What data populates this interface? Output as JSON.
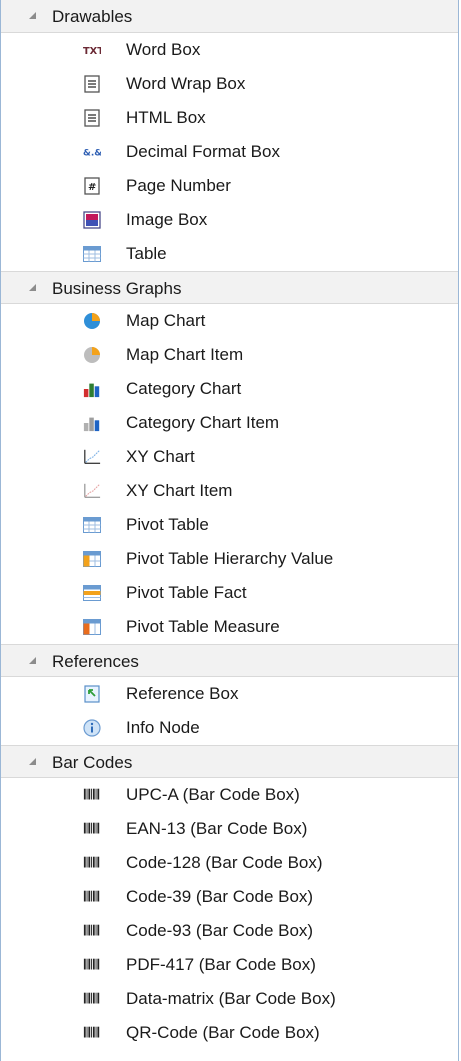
{
  "groups": [
    {
      "label": "Drawables",
      "items": [
        {
          "label": "Word Box",
          "icon": "txt-icon"
        },
        {
          "label": "Word Wrap Box",
          "icon": "document-text-icon"
        },
        {
          "label": "HTML Box",
          "icon": "document-text-icon"
        },
        {
          "label": "Decimal Format Box",
          "icon": "decimal-format-icon"
        },
        {
          "label": "Page Number",
          "icon": "page-number-icon"
        },
        {
          "label": "Image Box",
          "icon": "image-icon"
        },
        {
          "label": "Table",
          "icon": "table-icon"
        }
      ]
    },
    {
      "label": "Business Graphs",
      "items": [
        {
          "label": "Map Chart",
          "icon": "pie-chart-icon"
        },
        {
          "label": "Map Chart Item",
          "icon": "pie-chart-item-icon"
        },
        {
          "label": "Category Chart",
          "icon": "bar-chart-icon"
        },
        {
          "label": "Category Chart Item",
          "icon": "bar-chart-item-icon"
        },
        {
          "label": "XY Chart",
          "icon": "xy-chart-icon"
        },
        {
          "label": "XY Chart Item",
          "icon": "xy-chart-item-icon"
        },
        {
          "label": "Pivot Table",
          "icon": "table-icon"
        },
        {
          "label": "Pivot Table Hierarchy Value",
          "icon": "pivot-hierarchy-icon"
        },
        {
          "label": "Pivot Table Fact",
          "icon": "pivot-fact-icon"
        },
        {
          "label": "Pivot Table Measure",
          "icon": "pivot-measure-icon"
        }
      ]
    },
    {
      "label": "References",
      "items": [
        {
          "label": "Reference Box",
          "icon": "reference-icon"
        },
        {
          "label": "Info Node",
          "icon": "info-icon"
        }
      ]
    },
    {
      "label": "Bar Codes",
      "items": [
        {
          "label": "UPC-A (Bar Code Box)",
          "icon": "barcode-icon"
        },
        {
          "label": "EAN-13 (Bar Code Box)",
          "icon": "barcode-icon"
        },
        {
          "label": "Code-128 (Bar Code Box)",
          "icon": "barcode-icon"
        },
        {
          "label": "Code-39 (Bar Code Box)",
          "icon": "barcode-icon"
        },
        {
          "label": "Code-93 (Bar Code Box)",
          "icon": "barcode-icon"
        },
        {
          "label": "PDF-417 (Bar Code Box)",
          "icon": "barcode-icon"
        },
        {
          "label": "Data-matrix (Bar Code Box)",
          "icon": "barcode-icon"
        },
        {
          "label": "QR-Code (Bar Code Box)",
          "icon": "barcode-icon"
        }
      ]
    }
  ]
}
